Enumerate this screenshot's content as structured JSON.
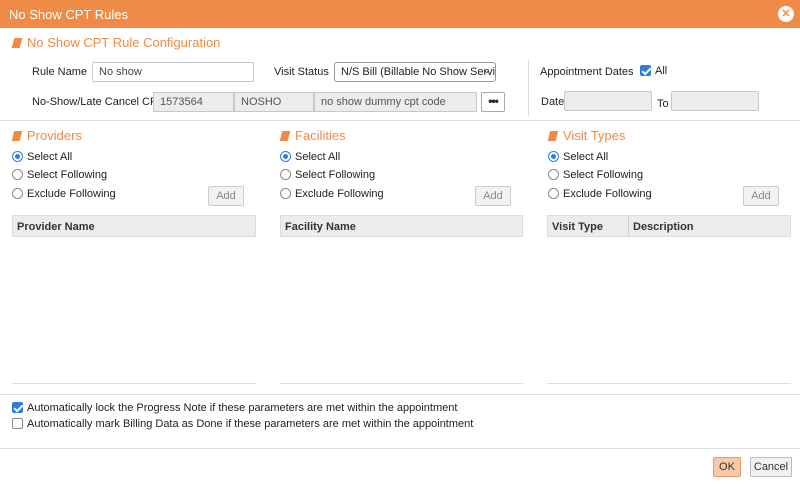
{
  "window": {
    "title": "No Show CPT Rules"
  },
  "config": {
    "section_title": "No Show CPT Rule Configuration",
    "rule_name_label": "Rule Name",
    "rule_name_value": "No show",
    "visit_status_label": "Visit Status",
    "visit_status_value": "N/S Bill (Billable No Show Servi",
    "cpt_label": "No-Show/Late Cancel CPT",
    "cpt_code": "1573564",
    "cpt_short": "NOSHO",
    "cpt_description": "no show dummy cpt code",
    "appointment_dates_label": "Appointment Dates",
    "all_label": "All",
    "all_checked": true,
    "date_label": "Date",
    "to_label": "To",
    "date_from": "",
    "date_to": ""
  },
  "providers": {
    "title": "Providers",
    "options": [
      "Select All",
      "Select Following",
      "Exclude Following"
    ],
    "selected": 0,
    "add_label": "Add",
    "columns": [
      "Provider Name"
    ]
  },
  "facilities": {
    "title": "Facilities",
    "options": [
      "Select All",
      "Select Following",
      "Exclude Following"
    ],
    "selected": 0,
    "add_label": "Add",
    "columns": [
      "Facility Name"
    ]
  },
  "visit_types": {
    "title": "Visit Types",
    "options": [
      "Select All",
      "Select Following",
      "Exclude Following"
    ],
    "selected": 0,
    "add_label": "Add",
    "columns": [
      "Visit Type",
      "Description"
    ]
  },
  "footer": {
    "lock_label": "Automatically lock the Progress Note if these parameters are met within the appointment",
    "lock_checked": true,
    "billing_label": "Automatically mark Billing Data as Done if these parameters are met within the appointment",
    "billing_checked": false,
    "ok_label": "OK",
    "cancel_label": "Cancel"
  },
  "colors": {
    "accent": "#ef8b46",
    "checkbox": "#2a7de1"
  }
}
